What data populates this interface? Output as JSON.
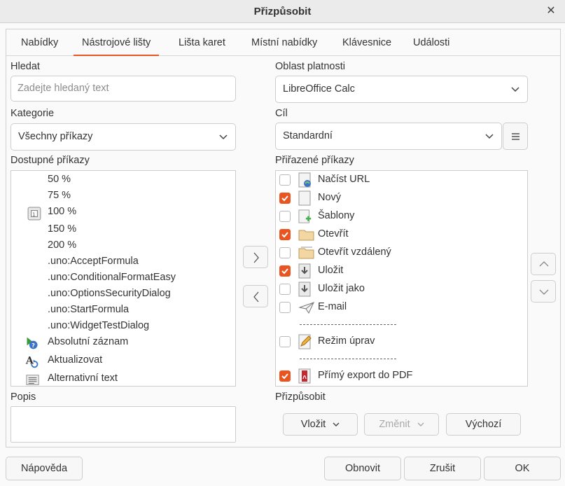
{
  "window": {
    "title": "Přizpůsobit",
    "close_glyph": "✕"
  },
  "tabs": [
    {
      "label": "Nabídky"
    },
    {
      "label": "Nástrojové lišty"
    },
    {
      "label": "Lišta karet"
    },
    {
      "label": "Místní nabídky"
    },
    {
      "label": "Klávesnice"
    },
    {
      "label": "Události"
    }
  ],
  "active_tab": "Nástrojové lišty",
  "accent_color": "#e95420",
  "left": {
    "search_label": "Hledat",
    "search_placeholder": "Zadejte hledaný text",
    "search_value": "",
    "category_label": "Kategorie",
    "category_value": "Všechny příkazy",
    "available_label": "Dostupné příkazy",
    "available": [
      {
        "label": "50 %",
        "icon": ""
      },
      {
        "label": "75 %",
        "icon": ""
      },
      {
        "label": "100 %",
        "icon": "zoom-100-icon"
      },
      {
        "label": "150 %",
        "icon": ""
      },
      {
        "label": "200 %",
        "icon": ""
      },
      {
        "label": ".uno:AcceptFormula",
        "icon": ""
      },
      {
        "label": ".uno:ConditionalFormatEasy",
        "icon": ""
      },
      {
        "label": ".uno:OptionsSecurityDialog",
        "icon": ""
      },
      {
        "label": ".uno:StartFormula",
        "icon": ""
      },
      {
        "label": ".uno:WidgetTestDialog",
        "icon": ""
      },
      {
        "label": "Absolutní záznam",
        "icon": "absolute-record-icon"
      },
      {
        "label": "Aktualizovat",
        "icon": "refresh-text-icon"
      },
      {
        "label": "Alternativní text",
        "icon": "alt-text-icon"
      }
    ],
    "description_label": "Popis",
    "description_value": ""
  },
  "right": {
    "scope_label": "Oblast platnosti",
    "scope_value": "LibreOffice Calc",
    "target_label": "Cíl",
    "target_value": "Standardní",
    "assigned_label": "Přiřazené příkazy",
    "assigned": [
      {
        "label": "Načíst URL",
        "checked": false,
        "icon": "load-url-icon"
      },
      {
        "label": "Nový",
        "checked": true,
        "icon": "new-document-icon"
      },
      {
        "label": "Šablony",
        "checked": false,
        "icon": "templates-icon"
      },
      {
        "label": "Otevřít",
        "checked": true,
        "icon": "open-folder-icon"
      },
      {
        "label": "Otevřít vzdálený",
        "checked": false,
        "icon": "open-remote-icon"
      },
      {
        "label": "Uložit",
        "checked": true,
        "icon": "save-icon"
      },
      {
        "label": "Uložit jako",
        "checked": false,
        "icon": "save-as-icon"
      },
      {
        "label": "E-mail",
        "checked": false,
        "icon": "email-icon"
      },
      {
        "separator": true
      },
      {
        "label": "Režim úprav",
        "checked": false,
        "icon": "edit-mode-icon"
      },
      {
        "separator": true
      },
      {
        "label": "Přímý export do PDF",
        "checked": true,
        "icon": "pdf-export-icon"
      }
    ],
    "customize_label": "Přizpůsobit",
    "insert_label": "Vložit",
    "modify_label": "Změnit",
    "defaults_label": "Výchozí"
  },
  "footer": {
    "help_label": "Nápověda",
    "reset_label": "Obnovit",
    "cancel_label": "Zrušit",
    "ok_label": "OK"
  }
}
